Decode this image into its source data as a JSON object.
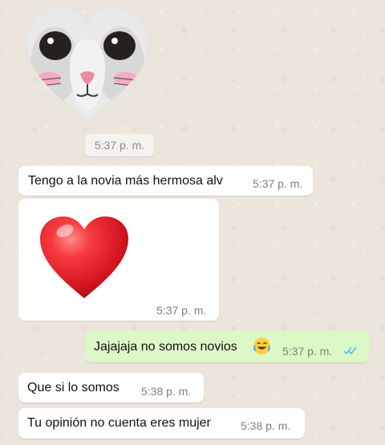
{
  "chat": {
    "first_time": "5:37 p. m.",
    "messages": [
      {
        "text": "Tengo a la novia más hermosa alv",
        "time": "5:37 p. m."
      },
      {
        "text": "",
        "time": "5:37 p. m.",
        "icon": "heart-emoji"
      },
      {
        "text": "Jajajaja no somos novios",
        "time": "5:37 p. m.",
        "icon": "laughing-crying-emoji",
        "status_icon": "double-check-icon"
      },
      {
        "text": "Que si lo somos",
        "time": "5:38 p. m."
      },
      {
        "text": "Tu opinión no cuenta eres mujer",
        "time": "5:38 p. m."
      }
    ]
  },
  "colors": {
    "background": "#ebe5dc",
    "incoming_bubble": "#ffffff",
    "outgoing_bubble": "#dcf8c6",
    "read_check": "#4fc3f7",
    "heart": "#e3262e"
  },
  "sticker": {
    "icon": "heart-cat-sticker"
  }
}
